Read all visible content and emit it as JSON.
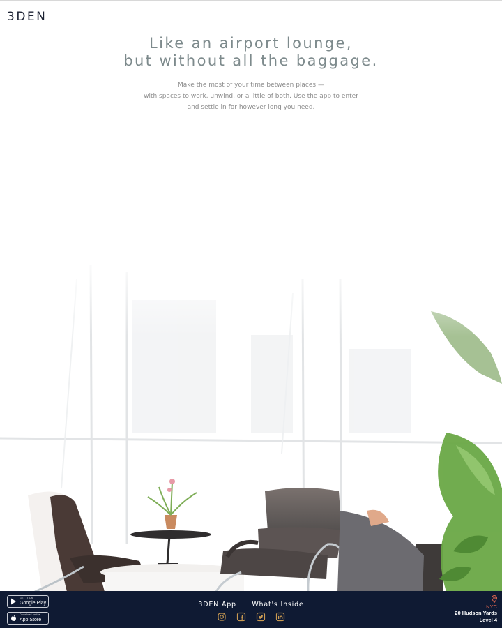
{
  "brand": {
    "logo_text": "3DEN"
  },
  "hero": {
    "headline_line1": "Like an airport lounge,",
    "headline_line2": "but without all the baggage.",
    "sub_line1": "Make the most of your time between places —",
    "sub_line2": "with spaces to work, unwind, or a little of both. Use the app to enter",
    "sub_line3": "and settle in for however long you need."
  },
  "footer": {
    "google_play": {
      "small": "GET IT ON",
      "big": "Google Play",
      "icon": "play-triangle-icon"
    },
    "app_store": {
      "small": "Download on the",
      "big": "App Store",
      "icon": "apple-icon"
    },
    "nav": [
      {
        "label": "3DEN App"
      },
      {
        "label": "What's Inside"
      }
    ],
    "social": [
      "instagram-icon",
      "facebook-icon",
      "twitter-icon",
      "linkedin-icon"
    ],
    "location": {
      "city": "NYC",
      "line1": "20 Hudson Yards",
      "line2": "Level 4"
    },
    "colors": {
      "background": "#0f1a33",
      "accent": "#e0664f",
      "social": "#c99a52"
    }
  }
}
